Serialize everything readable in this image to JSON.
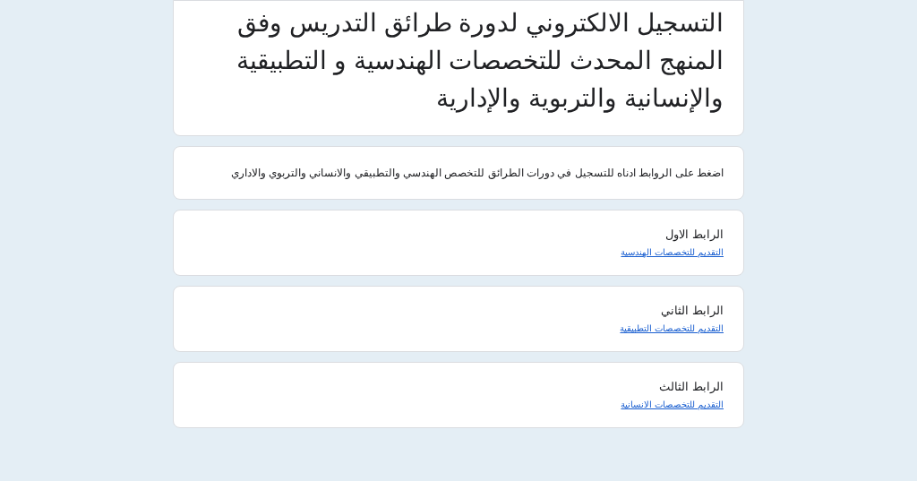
{
  "title": "التسجيل الالكتروني لدورة طرائق التدريس وفق المنهج المحدث للتخصصات  الهندسية و التطبيقية والإنسانية والتربوية والإدارية",
  "description": "اضغط على الروابط ادناه للتسجيل في دورات الطرائق للتخصص الهندسي والتطبيقي والانساني والتربوي والاداري",
  "links": [
    {
      "label": "الرابط الاول",
      "link": "التقديم للتخصصات الهندسية"
    },
    {
      "label": "الرابط الثاني",
      "link": "التقديم للتخصصات التطبيقية"
    },
    {
      "label": "الرابط الثالث",
      "link": "التقديم للتخصصات الانسانية"
    }
  ]
}
